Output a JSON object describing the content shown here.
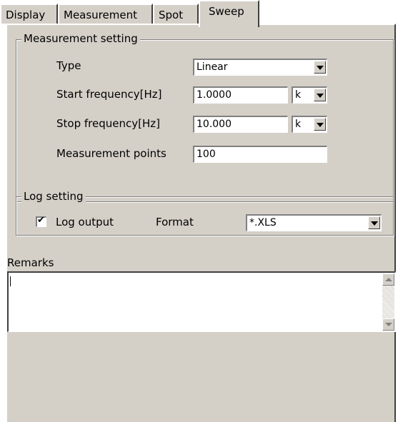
{
  "tabs": [
    {
      "label": "Display"
    },
    {
      "label": "Measurement"
    },
    {
      "label": "Spot"
    },
    {
      "label": "Sweep"
    }
  ],
  "measurement_setting": {
    "title": "Measurement setting",
    "type_label": "Type",
    "type_value": "Linear",
    "start_label": "Start frequency[Hz]",
    "start_value": "1.0000",
    "start_unit": "k",
    "stop_label": "Stop frequency[Hz]",
    "stop_value": "10.000",
    "stop_unit": "k",
    "points_label": "Measurement points",
    "points_value": "100"
  },
  "log_setting": {
    "title": "Log setting",
    "log_output_label": "Log output",
    "log_output_checked": true,
    "format_label": "Format",
    "format_value": "*.XLS"
  },
  "remarks": {
    "label": "Remarks",
    "value": ""
  }
}
